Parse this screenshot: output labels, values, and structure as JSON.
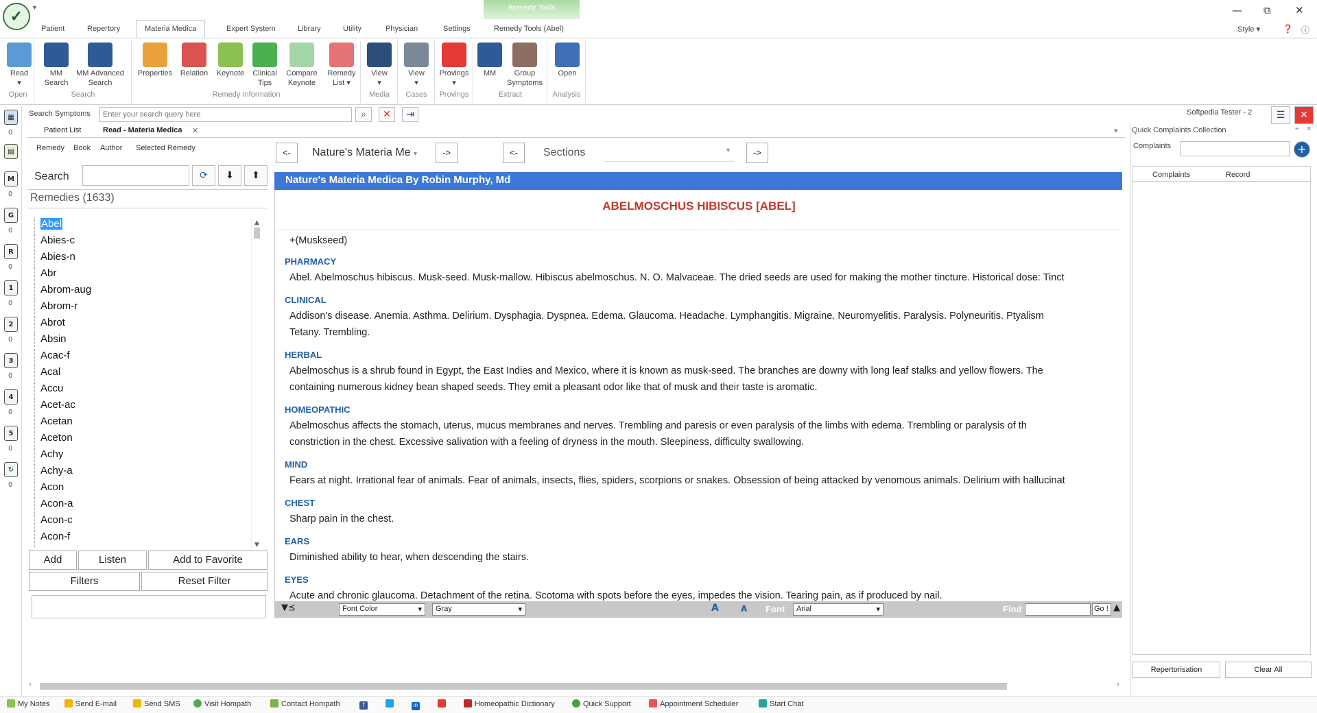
{
  "menu": {
    "tabs": [
      "Patient",
      "Repertory",
      "Materia Medica",
      "Expert System",
      "Library",
      "Utility",
      "Physician",
      "Settings",
      "Remedy Tools (Abel)"
    ],
    "active": "Materia Medica",
    "context_label": "Remedy Tools",
    "style_label": "Style"
  },
  "ribbon": {
    "groups": [
      "Open",
      "Search",
      "Remedy Information",
      "Media",
      "Cases",
      "Provings",
      "Extract",
      "Analysis"
    ],
    "buttons": [
      {
        "label": "Read",
        "sub": "▾"
      },
      {
        "label": "MM",
        "sub": "Search"
      },
      {
        "label": "MM Advanced",
        "sub": "Search"
      },
      {
        "label": "Properties",
        "sub": ""
      },
      {
        "label": "Relation",
        "sub": ""
      },
      {
        "label": "Keynote",
        "sub": ""
      },
      {
        "label": "Clinical",
        "sub": "Tips"
      },
      {
        "label": "Compare",
        "sub": "Keynote"
      },
      {
        "label": "Remedy",
        "sub": "List ▾"
      },
      {
        "label": "View",
        "sub": "▾"
      },
      {
        "label": "View",
        "sub": "▾"
      },
      {
        "label": "Provings",
        "sub": "▾"
      },
      {
        "label": "MM",
        "sub": ""
      },
      {
        "label": "Group",
        "sub": "Symptoms"
      },
      {
        "label": "Open",
        "sub": ""
      }
    ]
  },
  "search_symptoms": {
    "label": "Search Symptoms",
    "placeholder": "Enter your search query here"
  },
  "user": "Softpedia Tester - 2",
  "left_bar": {
    "counts": [
      "0",
      "0",
      "0",
      "0",
      "0",
      "0",
      "0",
      "0",
      "0",
      "0"
    ],
    "letters": [
      "M",
      "G",
      "R",
      "1",
      "2",
      "3",
      "4",
      "5"
    ]
  },
  "doc_tabs": [
    "Patient List",
    "Read - Materia Medica"
  ],
  "subnav": [
    "Remedy",
    "Book",
    "Author",
    "Selected Remedy"
  ],
  "remedy_panel": {
    "search_label": "Search",
    "header": "Remedies (1633)",
    "items": [
      "Abel",
      "Abies-c",
      "Abies-n",
      "Abr",
      "Abrom-aug",
      "Abrom-r",
      "Abrot",
      "Absin",
      "Acac-f",
      "Acal",
      "Accu",
      "Acet-ac",
      "Acetan",
      "Aceton",
      "Achy",
      "Achy-a",
      "Acon",
      "Acon-a",
      "Acon-c",
      "Acon-f"
    ],
    "selected": "Abel",
    "buttons": {
      "add": "Add",
      "listen": "Listen",
      "favorite": "Add to Favorite",
      "filters": "Filters",
      "reset": "Reset Filter"
    }
  },
  "book_nav": {
    "prev": "<-",
    "next": "->",
    "book": "Nature's Materia Me",
    "sections_label": "Sections"
  },
  "reader": {
    "book_title": "Nature's Materia Medica By Robin Murphy, Md",
    "heading": "ABELMOSCHUS HIBISCUS [ABEL]",
    "intro": "+(Muskseed)",
    "sections": [
      {
        "title": "PHARMACY",
        "text": "Abel. Abelmoschus hibiscus. Musk-seed. Musk-mallow. Hibiscus abelmoschus. N. O. Malvaceae. The dried seeds are used for making the mother tincture. Historical dose: Tinct"
      },
      {
        "title": "CLINICAL",
        "text": "Addison's disease. Anemia. Asthma. Delirium. Dysphagia. Dyspnea. Edema. Glaucoma. Headache. Lymphangitis. Migraine. Neuromyelitis. Paralysis. Polyneuritis. Ptyalism",
        "text2": "Tetany. Trembling."
      },
      {
        "title": "HERBAL",
        "text": "Abelmoschus is a shrub found in Egypt, the East Indies and Mexico, where it is known as musk-seed. The branches are downy with long leaf stalks and yellow flowers. The",
        "text2": "containing numerous kidney bean shaped seeds. They emit a pleasant odor like that of musk and their taste is aromatic."
      },
      {
        "title": "HOMEOPATHIC",
        "text": "Abelmoschus affects the stomach, uterus, mucus membranes and nerves. Trembling and paresis or even paralysis of the limbs with edema. Trembling or paralysis of th",
        "text2": "constriction in the chest. Excessive salivation with a feeling of dryness in the mouth. Sleepiness, difficulty swallowing."
      },
      {
        "title": "MIND",
        "text": "Fears at night. Irrational fear of animals. Fear of animals, insects, flies, spiders, scorpions or snakes. Obsession of being attacked by venomous animals. Delirium with hallucinat"
      },
      {
        "title": "CHEST",
        "text": "Sharp pain in the chest."
      },
      {
        "title": "EARS",
        "text": "Diminished ability to hear, when descending the stairs."
      },
      {
        "title": "EYES",
        "text": "Acute and chronic glaucoma. Detachment of the retina. Scotoma with spots before the eyes, impedes the vision. Tearing pain, as if produced by nail."
      }
    ]
  },
  "reader_toolbar": {
    "font_color": "Font Color",
    "color_value": "Gray",
    "font_label": "Font",
    "font_value": "Arial",
    "find_label": "Find",
    "go": "Go !"
  },
  "right_panel": {
    "title": "Quick Complaints Collection",
    "complaints_label": "Complaints",
    "columns": [
      "Complaints",
      "Record"
    ],
    "repertorisation": "Repertorisation",
    "clear_all": "Clear All"
  },
  "statusbar": [
    "My Notes",
    "Send E-mail",
    "Send SMS",
    "Visit Hompath",
    "Contact Hompath",
    "",
    "",
    "",
    "",
    "Homeopathic Dictionary",
    "Quick Support",
    "Appointment Scheduler",
    "Start Chat"
  ],
  "colors": {
    "accent": "#3d78d8",
    "heading": "#c0392b",
    "section": "#1f5fa8"
  }
}
